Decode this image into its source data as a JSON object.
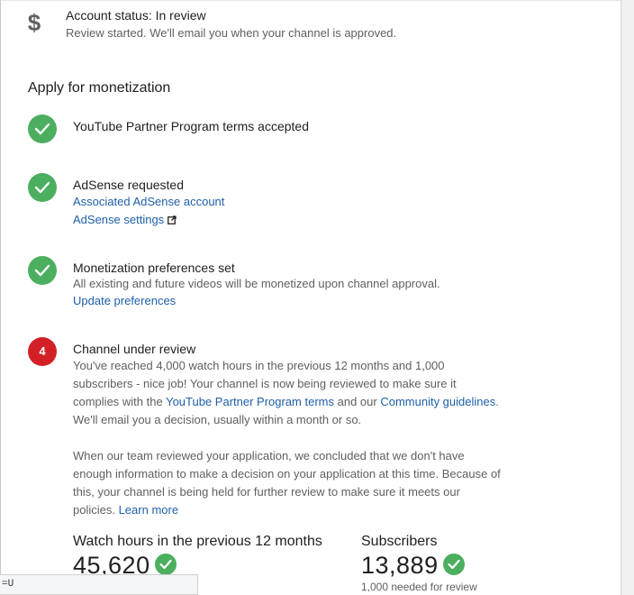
{
  "status": {
    "icon": "dollar-icon",
    "icon_glyph": "$",
    "title": "Account status: In review",
    "subtitle": "Review started. We'll email you when your channel is approved."
  },
  "section_title": "Apply for monetization",
  "steps": [
    {
      "state": "done",
      "title": "YouTube Partner Program terms accepted"
    },
    {
      "state": "done",
      "title": "AdSense requested",
      "link1": "Associated AdSense account",
      "link2": "AdSense settings"
    },
    {
      "state": "done",
      "title": "Monetization preferences set",
      "text": "All existing and future videos will be monetized upon channel approval.",
      "link1": "Update preferences"
    },
    {
      "state": "pending",
      "number": "4",
      "title": "Channel under review",
      "para1_a": "You've reached 4,000 watch hours in the previous 12 months and 1,000 subscribers - nice job! Your channel is now being reviewed to make sure it complies with the ",
      "para1_link1": "YouTube Partner Program terms",
      "para1_b": " and our ",
      "para1_link2": "Community guidelines",
      "para1_c": ". We'll email you a decision, usually within a month or so.",
      "para2": "When our team reviewed your application, we concluded that we don't have enough information to make a decision on your application at this time. Because of this, your channel is being held for further review to make sure it meets our policies. ",
      "para2_link": "Learn more"
    }
  ],
  "metrics": {
    "watch_hours": {
      "label": "Watch hours in the previous 12 months",
      "value": "45,620"
    },
    "subscribers": {
      "label": "Subscribers",
      "value": "13,889",
      "note": "1,000 needed for review"
    }
  },
  "status_bar_url": "=U",
  "colors": {
    "success": "#4caf60",
    "pending": "#d32027",
    "link": "#1f5fa8"
  }
}
